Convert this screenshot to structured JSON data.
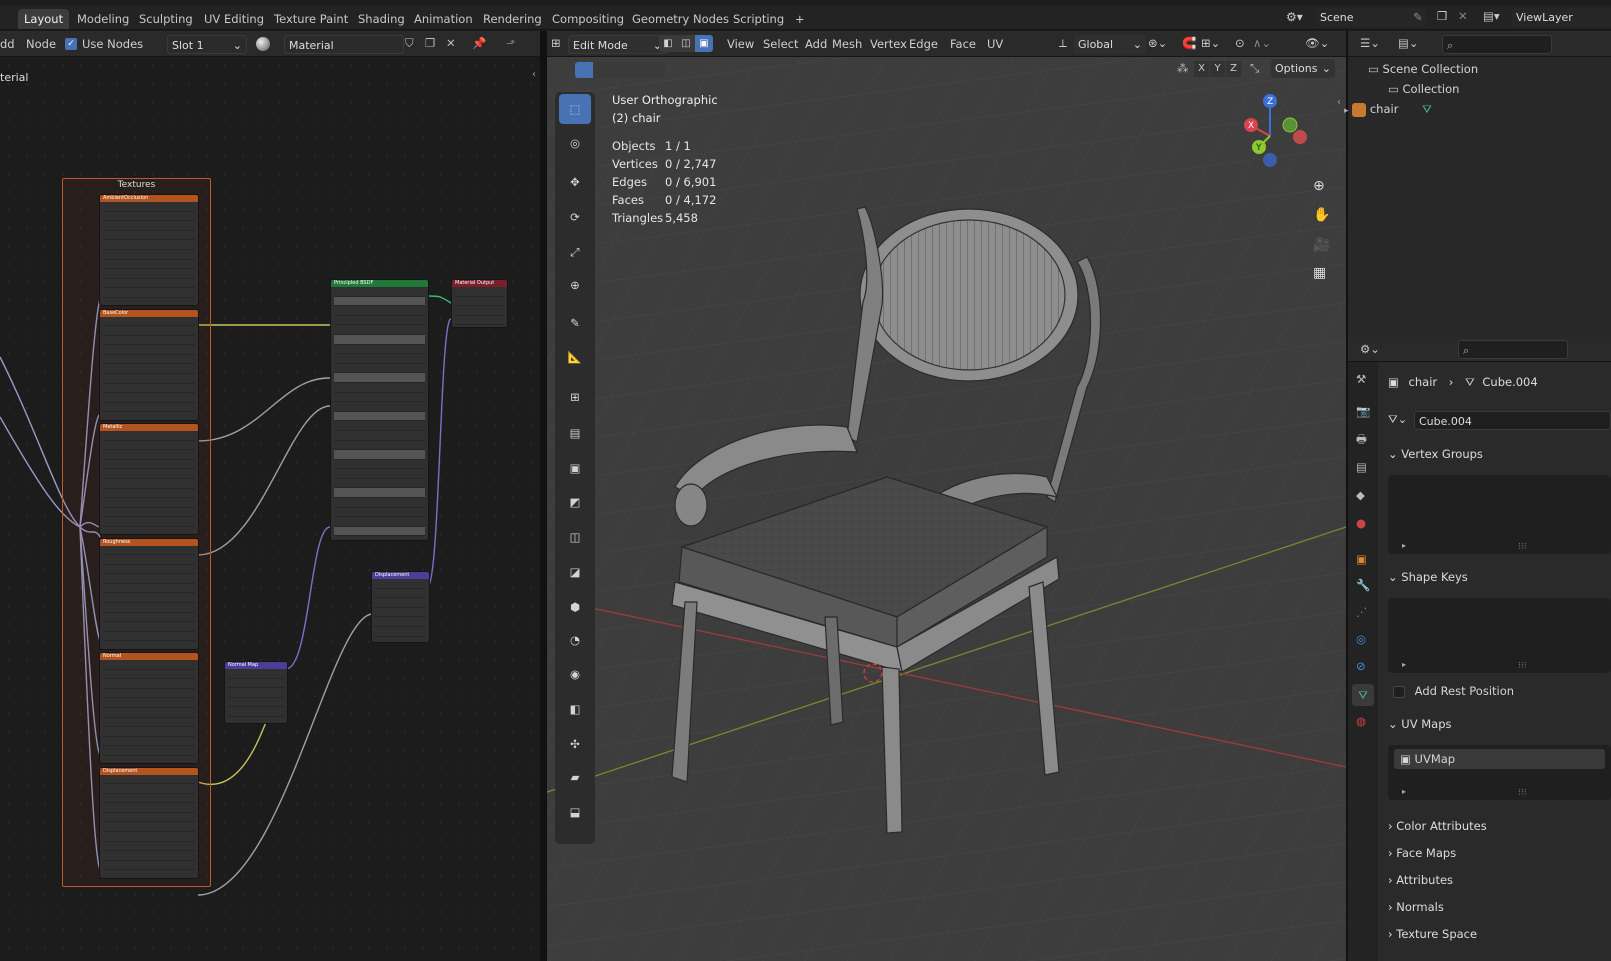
{
  "workspace_tabs": [
    "Layout",
    "Modeling",
    "Sculpting",
    "UV Editing",
    "Texture Paint",
    "Shading",
    "Animation",
    "Rendering",
    "Compositing",
    "Geometry Nodes",
    "Scripting",
    "+"
  ],
  "active_tab": "Layout",
  "scene": {
    "name": "Scene",
    "view_layer": "ViewLayer"
  },
  "node_header": {
    "add": "dd",
    "node": "Node",
    "use_nodes": "Use Nodes",
    "slot": "Slot 1",
    "material": "Material",
    "breadcrumb": "terial"
  },
  "node_editor": {
    "frame_label": "Textures",
    "texture_nodes": [
      "AmbientOcclusion",
      "BaseColor",
      "Metallic",
      "Roughness",
      "Normal",
      "Displacement"
    ],
    "principled_label": "Principled BSDF",
    "output_label": "Material Output",
    "displacement_label": "Displacement",
    "normalmap_label": "Normal Map",
    "colors": {
      "image_node": "#b3541f",
      "shader_node": "#1f7a3a",
      "output_node": "#7a1f2a",
      "vector_node": "#4b3e96"
    }
  },
  "viewport_header": {
    "mode": "Edit Mode",
    "menus": [
      "View",
      "Select",
      "Add",
      "Mesh",
      "Vertex",
      "Edge",
      "Face",
      "UV"
    ],
    "transform": "Global",
    "options": "Options",
    "axes": [
      "X",
      "Y",
      "Z"
    ]
  },
  "viewport_info": {
    "view_name": "User Orthographic",
    "object": "(2) chair",
    "stats": [
      {
        "label": "Objects",
        "value": "1 / 1"
      },
      {
        "label": "Vertices",
        "value": "0 / 2,747"
      },
      {
        "label": "Edges",
        "value": "0 / 6,901"
      },
      {
        "label": "Faces",
        "value": "0 / 4,172"
      },
      {
        "label": "Triangles",
        "value": "5,458"
      }
    ]
  },
  "outliner": {
    "scene_collection": "Scene Collection",
    "collection": "Collection",
    "object": "chair"
  },
  "properties": {
    "breadcrumb_object": "chair",
    "breadcrumb_mesh": "Cube.004",
    "mesh_name": "Cube.004",
    "panels": {
      "vertex_groups": "Vertex Groups",
      "shape_keys": "Shape Keys",
      "add_rest_position": "Add Rest Position",
      "uv_maps": "UV Maps",
      "uv_map_item": "UVMap",
      "color_attributes": "Color Attributes",
      "face_maps": "Face Maps",
      "attributes": "Attributes",
      "normals": "Normals",
      "texture_space": "Texture Space"
    }
  }
}
